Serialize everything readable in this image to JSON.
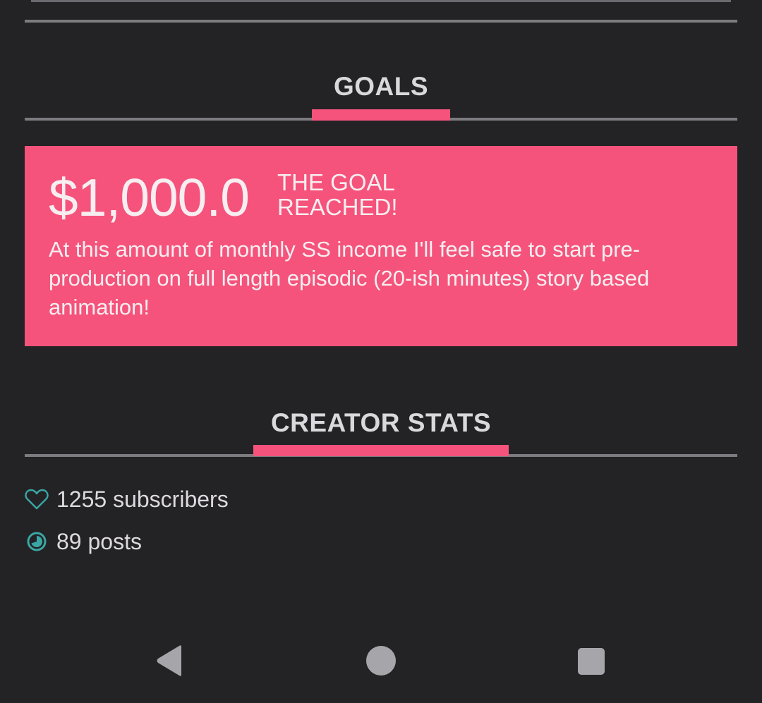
{
  "goals": {
    "title": "GOALS",
    "card": {
      "amount": "$1,000.0",
      "status": "THE GOAL\nREACHED!",
      "description": "At this amount of monthly SS income I'll feel safe to start pre-production on full length episodic (20-ish minutes) story based animation!"
    }
  },
  "creator_stats": {
    "title": "CREATOR STATS",
    "items": [
      {
        "icon": "heart-icon",
        "text": "1255 subscribers"
      },
      {
        "icon": "posts-icon",
        "text": "89 posts"
      }
    ]
  },
  "navbar": {
    "back": "back-icon",
    "home": "home-icon",
    "recents": "recents-icon"
  },
  "colors": {
    "accent": "#f5537b",
    "background": "#232225",
    "icon_teal": "#3aa7a5"
  }
}
